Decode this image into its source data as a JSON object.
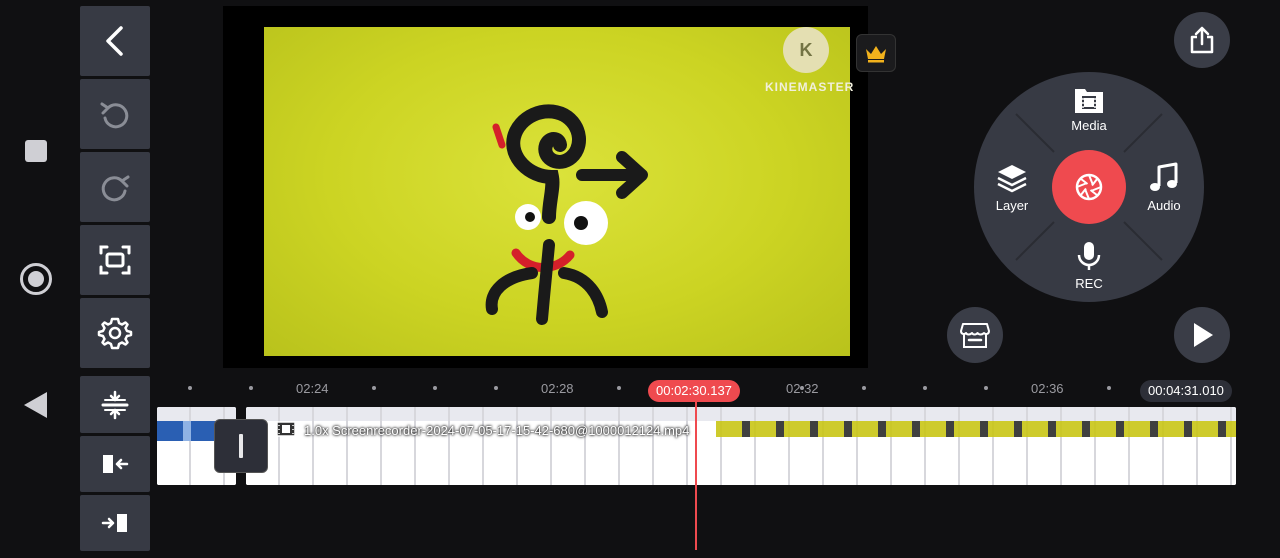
{
  "preview": {
    "watermark_letter": "K",
    "watermark_text": "KINEMASTER"
  },
  "wheel": {
    "media_label": "Media",
    "layer_label": "Layer",
    "audio_label": "Audio",
    "rec_label": "REC"
  },
  "timeline": {
    "tick_labels": [
      "02:24",
      "02:28",
      "02:32",
      "02:36"
    ],
    "current_time": "00:02:30.137",
    "total_time": "00:04:31.010",
    "clip_name": "1.0x Screenrecorder-2024-07-05-17-15-42-680@1000012124.mp4"
  },
  "colors": {
    "accent_red": "#ef4a4f",
    "panel": "#373a44",
    "video_background": "#ccd423"
  }
}
